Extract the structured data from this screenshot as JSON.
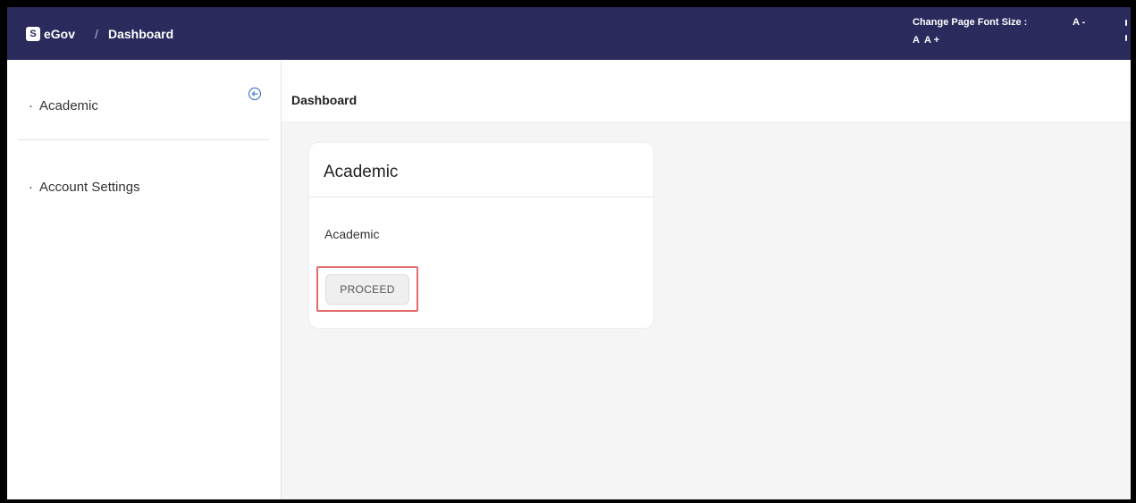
{
  "topbar": {
    "logo_letter": "S",
    "brand": "eGov",
    "separator": "/",
    "current": "Dashboard",
    "font_size_label": "Change Page Font Size :",
    "font_decrease": "A -",
    "font_normal": "A",
    "font_increase": "A +"
  },
  "sidebar": {
    "items": [
      {
        "bullet": "·",
        "label": "Academic"
      },
      {
        "bullet": "·",
        "label": "Account Settings"
      }
    ],
    "collapse_icon": "arrow-left-circle"
  },
  "main": {
    "title": "Dashboard",
    "card": {
      "title": "Academic",
      "text": "Academic",
      "button": "PROCEED"
    }
  },
  "colors": {
    "topbar_bg": "#2a2a5c",
    "highlight": "#e46b6b",
    "main_bg": "#f5f5f5"
  }
}
